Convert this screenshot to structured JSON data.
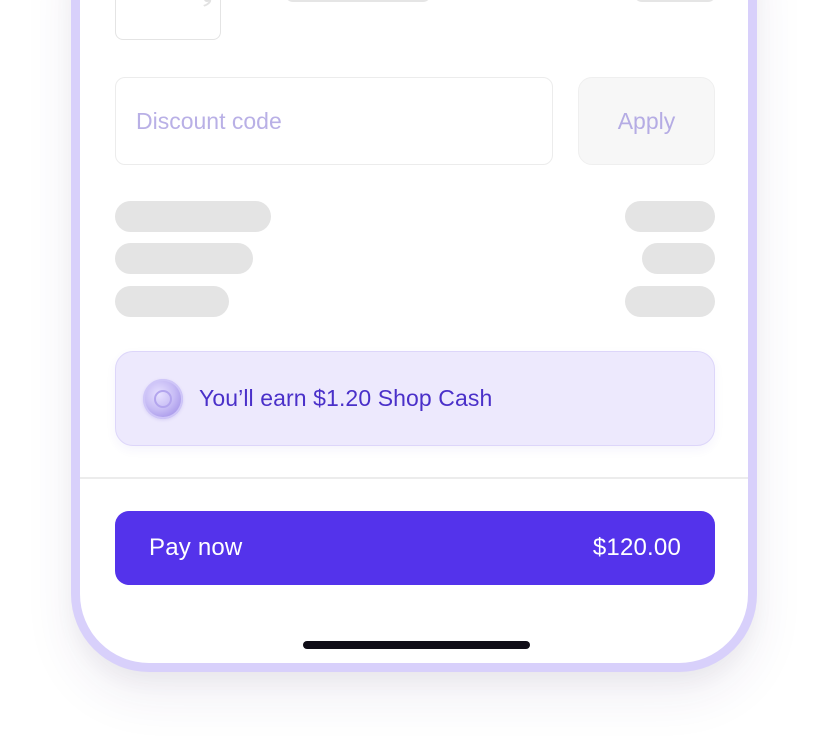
{
  "discount": {
    "placeholder": "Discount code",
    "value": ""
  },
  "apply_label": "Apply",
  "shop_cash": {
    "icon": "shop-cash-coin-icon",
    "text": "You’ll earn $1.20 Shop Cash"
  },
  "pay": {
    "label": "Pay now",
    "amount": "$120.00"
  },
  "colors": {
    "accent": "#5433eb",
    "device_frame": "#d8d0fb",
    "banner_background": "#ede9fd",
    "banner_text": "#4a30c9",
    "placeholder_text": "#b9b0e6",
    "skeleton": "#e4e4e4"
  }
}
